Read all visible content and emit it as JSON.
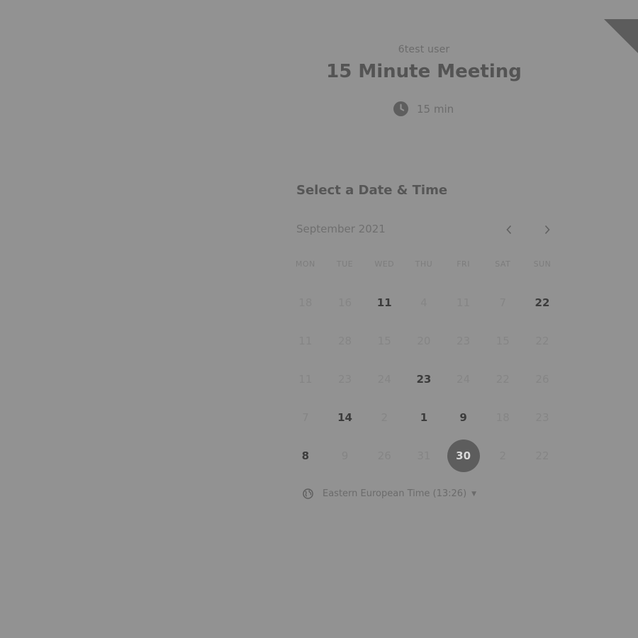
{
  "header": {
    "organizer": "6test user",
    "event_title": "15 Minute Meeting",
    "duration": "15 min"
  },
  "scheduler": {
    "section_title": "Select a Date & Time",
    "month": "September 2021",
    "weekdays": [
      "MON",
      "TUE",
      "WED",
      "THU",
      "FRI",
      "SAT",
      "SUN"
    ],
    "weeks": [
      [
        {
          "label": "18",
          "available": false
        },
        {
          "label": "16",
          "available": false
        },
        {
          "label": "11",
          "available": true
        },
        {
          "label": "4",
          "available": false
        },
        {
          "label": "11",
          "available": false
        },
        {
          "label": "7",
          "available": false
        },
        {
          "label": "22",
          "available": true
        }
      ],
      [
        {
          "label": "11",
          "available": false
        },
        {
          "label": "28",
          "available": false
        },
        {
          "label": "15",
          "available": false
        },
        {
          "label": "20",
          "available": false
        },
        {
          "label": "23",
          "available": false
        },
        {
          "label": "15",
          "available": false
        },
        {
          "label": "22",
          "available": false
        }
      ],
      [
        {
          "label": "11",
          "available": false
        },
        {
          "label": "23",
          "available": false
        },
        {
          "label": "24",
          "available": false
        },
        {
          "label": "23",
          "available": true
        },
        {
          "label": "24",
          "available": false
        },
        {
          "label": "22",
          "available": false
        },
        {
          "label": "26",
          "available": false
        }
      ],
      [
        {
          "label": "7",
          "available": false
        },
        {
          "label": "14",
          "available": true
        },
        {
          "label": "2",
          "available": false
        },
        {
          "label": "1",
          "available": true
        },
        {
          "label": "9",
          "available": true
        },
        {
          "label": "18",
          "available": false
        },
        {
          "label": "23",
          "available": false
        }
      ],
      [
        {
          "label": "8",
          "available": true
        },
        {
          "label": "9",
          "available": false
        },
        {
          "label": "26",
          "available": false
        },
        {
          "label": "31",
          "available": false
        },
        {
          "label": "30",
          "available": true,
          "selected": true
        },
        {
          "label": "2",
          "available": false
        },
        {
          "label": "22",
          "available": false
        }
      ]
    ],
    "timezone": "Eastern European Time (13:26)"
  },
  "icons": {
    "duration": "clock-icon",
    "prev": "chevron-left-icon",
    "next": "chevron-right-icon",
    "timezone": "globe-icon",
    "timezone_toggle": "caret-down-icon"
  },
  "colors": {
    "background": "#929292",
    "selected_day": "#5d5d5d",
    "corner_ribbon": "#5c5c5c"
  }
}
